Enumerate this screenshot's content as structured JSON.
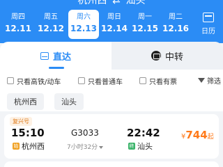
{
  "header": {
    "from_city": "杭州西",
    "to_city": "汕头",
    "swap_icon": "swap-arrows-icon"
  },
  "date_bar": {
    "dates": [
      {
        "weekday": "周四",
        "date": "12.11",
        "selected": false
      },
      {
        "weekday": "周五",
        "date": "12.12",
        "selected": false
      },
      {
        "weekday": "周六",
        "date": "12.13",
        "selected": true
      },
      {
        "weekday": "周日",
        "date": "12.14",
        "selected": false
      },
      {
        "weekday": "周一",
        "date": "12.15",
        "selected": false
      },
      {
        "weekday": "周二",
        "date": "12.16",
        "selected": false
      }
    ],
    "calendar_label": "日历",
    "calendar_icon": "calendar-icon"
  },
  "tabs": {
    "direct_label": "直达",
    "transfer_label": "中转"
  },
  "filters": {
    "high_speed_only": "只看高铁/动车",
    "regular_only": "只看普通车",
    "tickets_only": "只看有票",
    "filter_label": "筛选"
  },
  "stations": {
    "from": "杭州西",
    "to": "汕头"
  },
  "train": {
    "tag": "复兴号",
    "dep_time": "15:10",
    "arr_time": "22:42",
    "train_no": "G3033",
    "duration": "7小时32分",
    "price_currency": "¥",
    "price": "744",
    "price_suffix": "起",
    "dep_station": "杭州西",
    "arr_station": "汕头",
    "start_mark": "始",
    "end_mark": "终"
  },
  "colors": {
    "primary": "#2b8cf5",
    "price": "#ff7a1a",
    "tag": "#e07b1a"
  }
}
